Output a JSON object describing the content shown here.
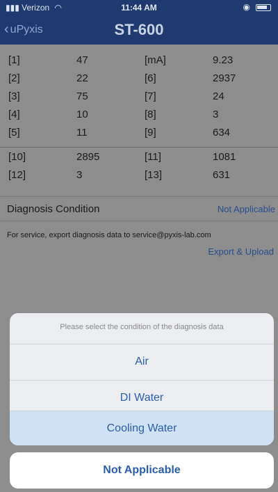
{
  "status": {
    "carrier": "Verizon",
    "time": "11:44 AM"
  },
  "nav": {
    "back_label": "uPyxis",
    "title": "ST-600"
  },
  "readings": [
    [
      "[1]",
      "47",
      "[mA]",
      "9.23"
    ],
    [
      "[2]",
      "22",
      "[6]",
      "2937"
    ],
    [
      "[3]",
      "75",
      "[7]",
      "24"
    ],
    [
      "[4]",
      "10",
      "[8]",
      "3"
    ],
    [
      "[5]",
      "11",
      "[9]",
      "634"
    ]
  ],
  "readings2": [
    [
      "[10]",
      "2895",
      "[11]",
      "1081"
    ],
    [
      "[12]",
      "3",
      "[13]",
      "631"
    ]
  ],
  "diagnosis": {
    "label": "Diagnosis Condition",
    "value": "Not Applicable"
  },
  "service_note": "For service, export diagnosis data to service@pyxis-lab.com",
  "export_label": "Export & Upload",
  "sheet": {
    "prompt": "Please select the condition of the diagnosis data",
    "options": [
      "Air",
      "DI Water",
      "Cooling Water"
    ],
    "cancel": "Not Applicable"
  },
  "icons": {
    "signal": "signal-bars-icon",
    "wifi": "wifi-icon",
    "battery": "battery-icon",
    "back": "chevron-left-icon"
  }
}
